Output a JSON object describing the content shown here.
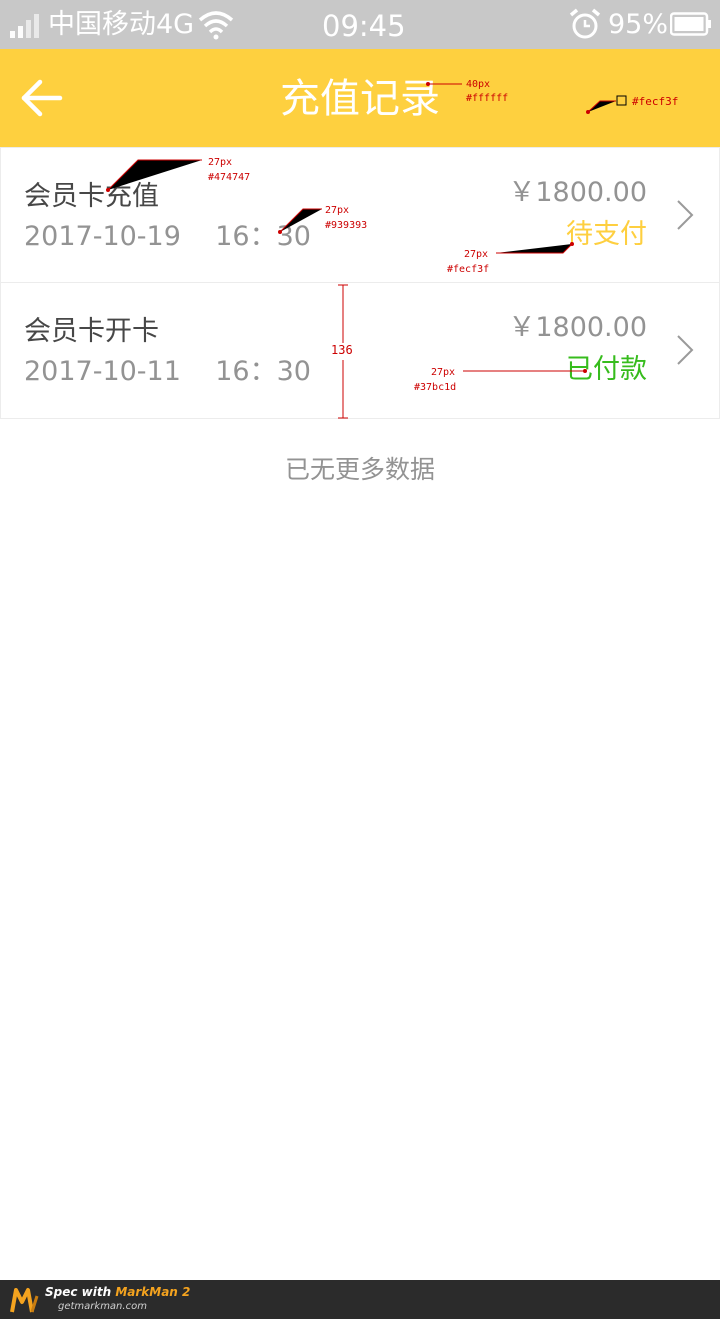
{
  "status_bar": {
    "carrier": "中国移动4G",
    "time": "09:45",
    "battery": "95%"
  },
  "header": {
    "title": "充值记录",
    "back_icon": "arrow-left-icon",
    "bg_color": "#fecf3f"
  },
  "records": [
    {
      "title": "会员卡充值",
      "date": "2017-10-19    16：30",
      "amount": "￥1800.00",
      "status": "待支付",
      "status_color": "#fecf3f"
    },
    {
      "title": "会员卡开卡",
      "date": "2017-10-11    16：30",
      "amount": "￥1800.00",
      "status": "已付款",
      "status_color": "#37bc1d"
    }
  ],
  "no_more_text": "已无更多数据",
  "annotations": {
    "title_size": "40px",
    "title_color": "#ffffff",
    "header_color": "#fecf3f",
    "row_title_size": "27px",
    "row_title_color": "#474747",
    "row_date_size": "27px",
    "row_date_color": "#939393",
    "pending_size": "27px",
    "pending_color": "#fecf3f",
    "paid_size": "27px",
    "paid_color": "#37bc1d",
    "row_height": "136"
  },
  "footer": {
    "spec_prefix": "Spec with ",
    "brand": "MarkMan 2",
    "site": "getmarkman.com"
  }
}
